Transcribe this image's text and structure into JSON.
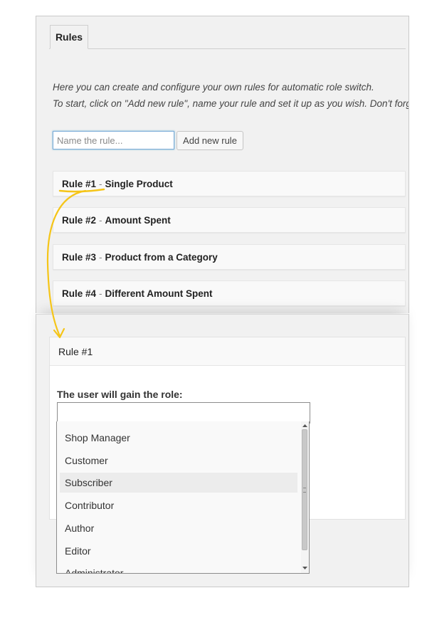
{
  "tabs": [
    {
      "label": "Rules",
      "active": true
    }
  ],
  "intro": {
    "line1": "Here you can create and configure your own rules for automatic role switch.",
    "line2": "To start, click on \"Add new rule\", name your rule and set it up as you wish. Don't forget"
  },
  "new_rule": {
    "placeholder": "Name the rule...",
    "value": "",
    "button_label": "Add new rule"
  },
  "rules": [
    {
      "number": "Rule #1",
      "separator": "-",
      "name": "Single Product"
    },
    {
      "number": "Rule #2",
      "separator": "-",
      "name": "Amount Spent"
    },
    {
      "number": "Rule #3",
      "separator": "-",
      "name": "Product from a Category"
    },
    {
      "number": "Rule #4",
      "separator": "-",
      "name": "Different Amount Spent"
    }
  ],
  "rule_detail": {
    "title": "Rule #1",
    "role_label": "The user will gain the role:",
    "selected_value": "",
    "options": [
      "Shop Manager",
      "Customer",
      "Subscriber",
      "Contributor",
      "Author",
      "Editor",
      "Administrator"
    ],
    "highlighted_option": "Subscriber"
  },
  "colors": {
    "panel_bg": "#f1f1f1",
    "rule_row_bg": "#f9f9f9",
    "annotation": "#f5c518",
    "input_focus_border": "#7eadd9"
  }
}
